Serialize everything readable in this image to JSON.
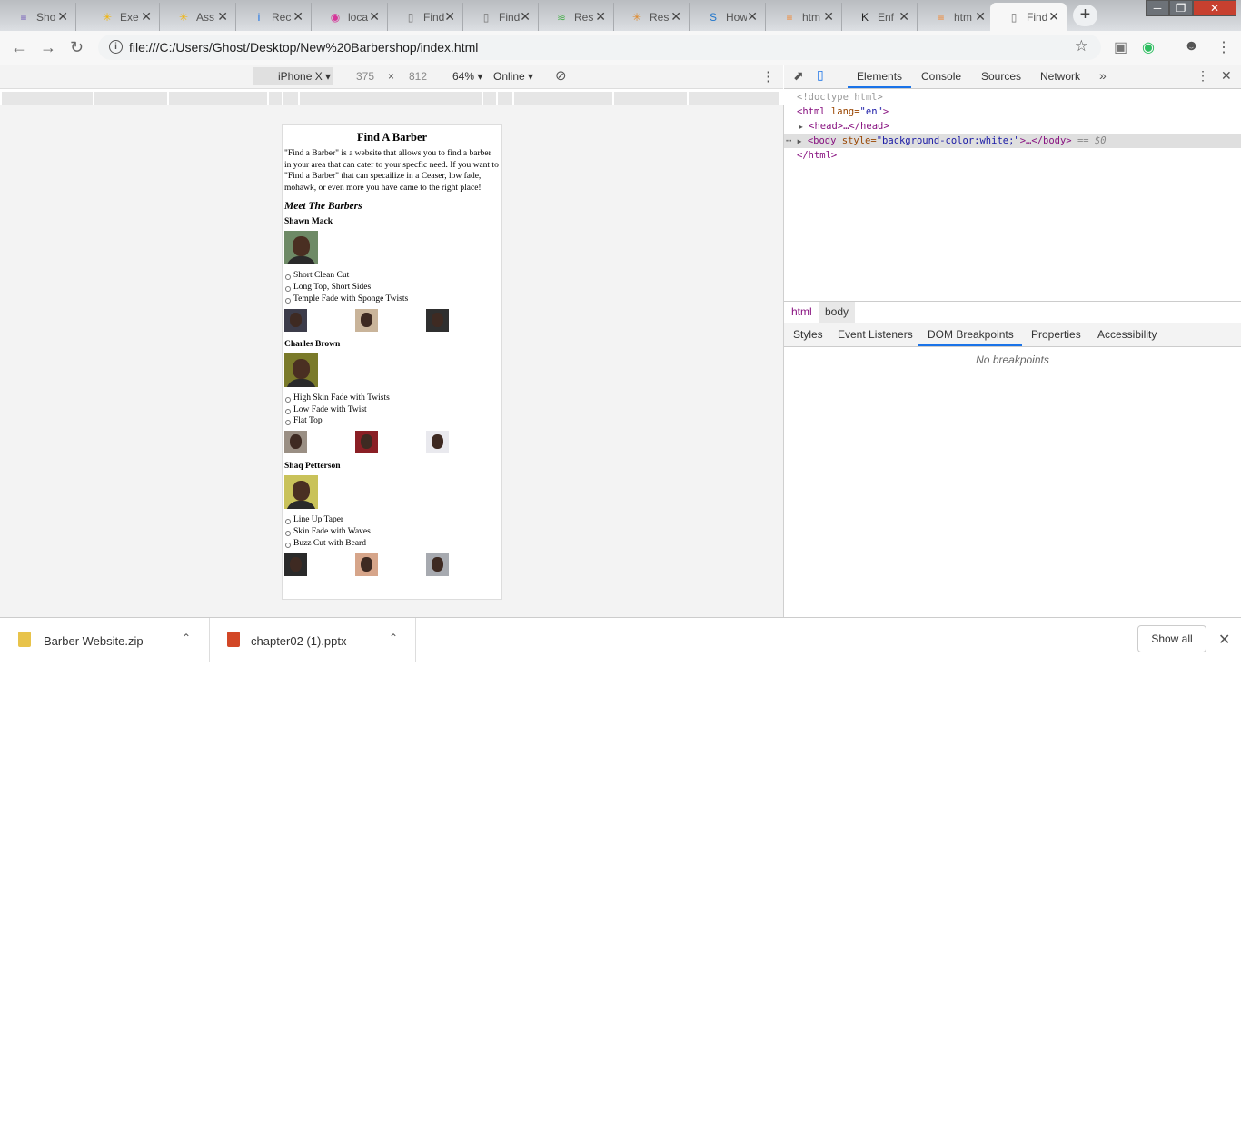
{
  "tabs": [
    {
      "title": "Sho",
      "icon": "graduation-cap-icon",
      "icon_glyph": "≡",
      "icon_color": "#6a4fb6"
    },
    {
      "title": "Exe",
      "icon": "walmart-spark-icon",
      "icon_glyph": "✳",
      "icon_color": "#f4b400"
    },
    {
      "title": "Ass",
      "icon": "walmart-spark-icon",
      "icon_glyph": "✳",
      "icon_color": "#f4b400"
    },
    {
      "title": "Rec",
      "icon": "info-icon",
      "icon_glyph": "i",
      "icon_color": "#1a73e8"
    },
    {
      "title": "loca",
      "icon": "localhost-icon",
      "icon_glyph": "◉",
      "icon_color": "#d6369a"
    },
    {
      "title": "Find",
      "icon": "page-icon",
      "icon_glyph": "▯",
      "icon_color": "#777777"
    },
    {
      "title": "Find",
      "icon": "page-icon",
      "icon_glyph": "▯",
      "icon_color": "#777777"
    },
    {
      "title": "Res",
      "icon": "resume-icon",
      "icon_glyph": "≋",
      "icon_color": "#4caf50"
    },
    {
      "title": "Res",
      "icon": "walmart-spark-icon",
      "icon_glyph": "✳",
      "icon_color": "#e08a2c"
    },
    {
      "title": "How",
      "icon": "s-circle-icon",
      "icon_glyph": "S",
      "icon_color": "#2277cc"
    },
    {
      "title": "htm",
      "icon": "stackoverflow-icon",
      "icon_glyph": "≡",
      "icon_color": "#f48024"
    },
    {
      "title": "Enf",
      "icon": "k-icon",
      "icon_glyph": "K",
      "icon_color": "#222222"
    },
    {
      "title": "htm",
      "icon": "stackoverflow-icon",
      "icon_glyph": "≡",
      "icon_color": "#f48024"
    },
    {
      "title": "Find",
      "icon": "page-icon",
      "icon_glyph": "▯",
      "icon_color": "#777777",
      "active": true
    }
  ],
  "toolbar": {
    "url": "file:///C:/Users/Ghost/Desktop/New%20Barbershop/index.html"
  },
  "device_toolbar": {
    "device": "iPhone X",
    "width": "375",
    "height": "812",
    "zoom": "64%",
    "network": "Online"
  },
  "page": {
    "title": "Find A Barber",
    "intro": "\"Find a Barber\" is a website that allows you to find a barber in your area that can cater to your specfic need. If you want to \"Find a Barber\" that can specailize in a Ceaser, low fade, mohawk, or even more you have came to the right place!",
    "section_title": "Meet The Barbers",
    "barbers": [
      {
        "name": "Shawn Mack",
        "styles": [
          "Short Clean Cut",
          "Long Top, Short Sides",
          "Temple Fade with Sponge Twists"
        ],
        "bg": "#6e8a66",
        "thumb_bgs": [
          "#3c3c4a",
          "#c9b49a",
          "#2f2f2f"
        ]
      },
      {
        "name": "Charles Brown",
        "styles": [
          "High Skin Fade with Twists",
          "Low Fade with Twist",
          "Flat Top"
        ],
        "bg": "#7a7a2a",
        "thumb_bgs": [
          "#9a8f84",
          "#8a1f25",
          "#e9e9ee"
        ]
      },
      {
        "name": "Shaq Petterson",
        "styles": [
          "Line Up Taper",
          "Skin Fade with Waves",
          "Buzz Cut with Beard"
        ],
        "bg": "#c9c25a",
        "thumb_bgs": [
          "#2a2a2a",
          "#d6a58a",
          "#a7aab0"
        ]
      }
    ]
  },
  "devtools": {
    "tabs": [
      "Elements",
      "Console",
      "Sources",
      "Network"
    ],
    "dom": {
      "doctype": "<!doctype html>",
      "html_open_tag": "<html",
      "html_attr": " lang=",
      "html_val": "\"en\"",
      "html_close": ">",
      "head": "<head>…</head>",
      "body_open": "<body",
      "body_attr": " style=",
      "body_val": "\"background-color:white;\"",
      "body_rest": ">…</body>",
      "body_meta": " == $0",
      "html_end": "</html>"
    },
    "crumbs": [
      "html",
      "body"
    ],
    "subtabs": [
      "Styles",
      "Event Listeners",
      "DOM Breakpoints",
      "Properties",
      "Accessibility"
    ],
    "no_breakpoints": "No breakpoints"
  },
  "downloads": [
    {
      "name": "Barber Website.zip",
      "icon": "zip-file-icon",
      "color": "#e8c34a"
    },
    {
      "name": "chapter02 (1).pptx",
      "icon": "pptx-file-icon",
      "color": "#d24726"
    }
  ],
  "shelf": {
    "show_all": "Show all"
  }
}
